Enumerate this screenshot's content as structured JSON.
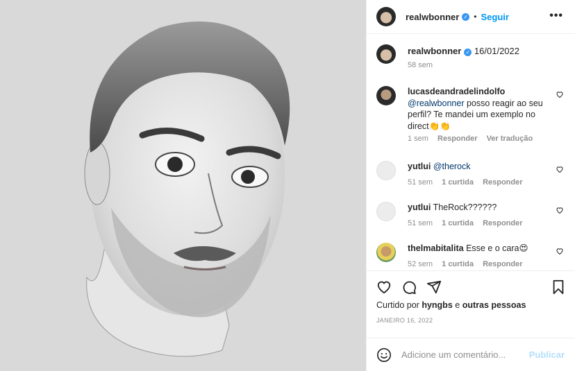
{
  "header": {
    "username": "realwbonner",
    "separator": "•",
    "follow_label": "Seguir",
    "more_icon": "more-horizontal-icon"
  },
  "caption": {
    "username": "realwbonner",
    "text": "16/01/2022",
    "time": "58 sem"
  },
  "comments": [
    {
      "username": "lucasdeandradelindolfo",
      "mention": "@realwbonner",
      "text": " posso reagir ao seu perfil? Te mandei um exemplo no direct👏👏",
      "time": "1 sem",
      "likes": "",
      "reply_label": "Responder",
      "translate_label": "Ver tradução"
    },
    {
      "username": "yutlui",
      "mention": "@therock",
      "text": "",
      "time": "51 sem",
      "likes": "1 curtida",
      "reply_label": "Responder"
    },
    {
      "username": "yutlui",
      "mention": "",
      "text": "TheRock??????",
      "time": "51 sem",
      "likes": "1 curtida",
      "reply_label": "Responder"
    },
    {
      "username": "thelmabitalita",
      "mention": "",
      "text": "Esse e o cara😍",
      "time": "52 sem",
      "likes": "1 curtida",
      "reply_label": "Responder"
    }
  ],
  "actions": {
    "liked_prefix": "Curtido por",
    "liked_user": "hyngbs",
    "liked_suffix": "e",
    "liked_others": "outras pessoas",
    "date": "JANEIRO 16, 2022"
  },
  "add_comment": {
    "placeholder": "Adicione um comentário...",
    "publish_label": "Publicar"
  },
  "colors": {
    "accent": "#0095f6",
    "verified": "#3897f0",
    "publish_disabled": "#b2dffc",
    "muted": "#8e8e8e"
  }
}
